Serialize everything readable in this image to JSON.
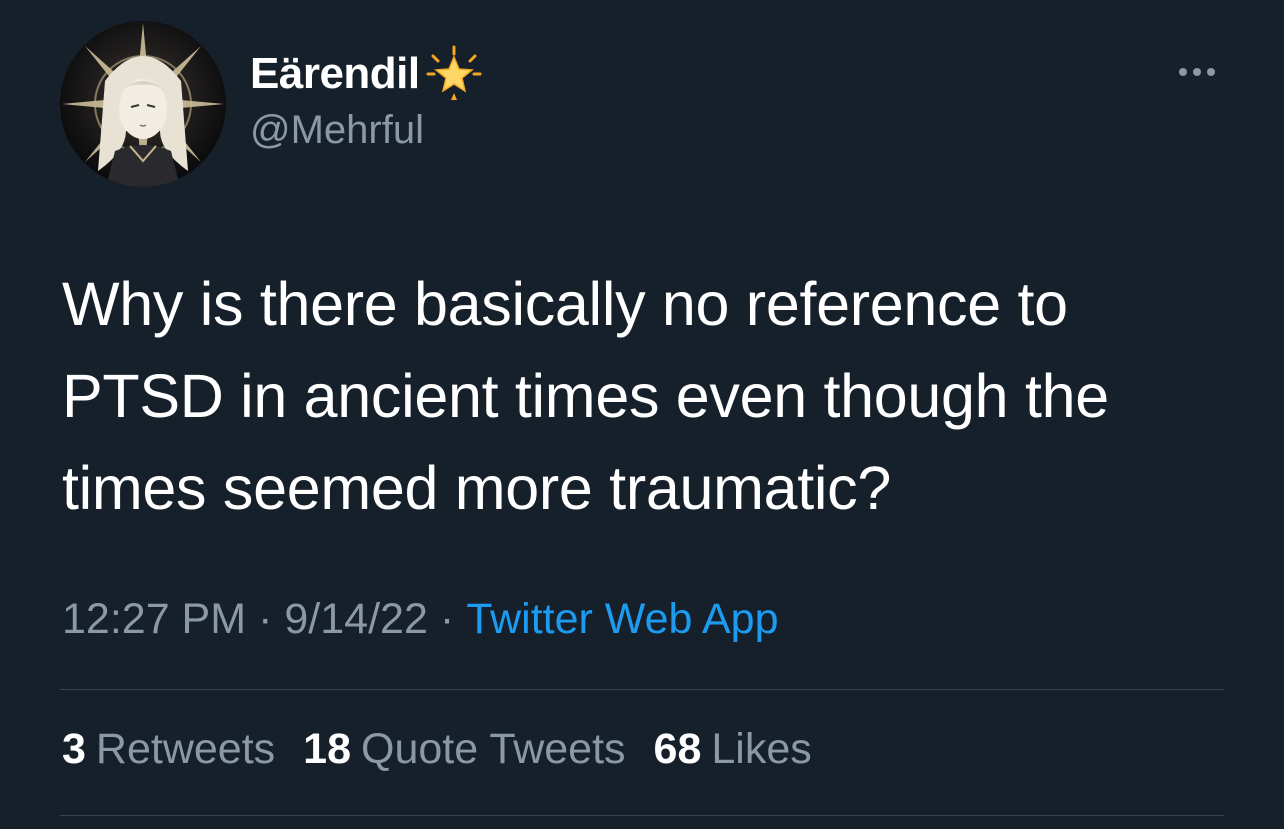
{
  "profile": {
    "display_name": "Eärendil",
    "handle": "@Mehrful",
    "badge_icon": "glowing-star-icon",
    "avatar_icon": "illustrated-avatar-icon"
  },
  "menu": {
    "more_icon": "more-options-icon"
  },
  "tweet": {
    "lines": [
      "Why is there basically no reference to",
      "PTSD in ancient times even though the",
      "times seemed more traumatic?"
    ]
  },
  "meta": {
    "time": "12:27 PM",
    "separator": "·",
    "date": "9/14/22",
    "source": "Twitter Web App"
  },
  "stats": [
    {
      "count": "3",
      "label": "Retweets"
    },
    {
      "count": "18",
      "label": "Quote Tweets"
    },
    {
      "count": "68",
      "label": "Likes"
    }
  ],
  "colors": {
    "background": "#15202b",
    "secondary_text": "#8b98a5",
    "link": "#1d9bf0",
    "divider": "#38444d"
  }
}
